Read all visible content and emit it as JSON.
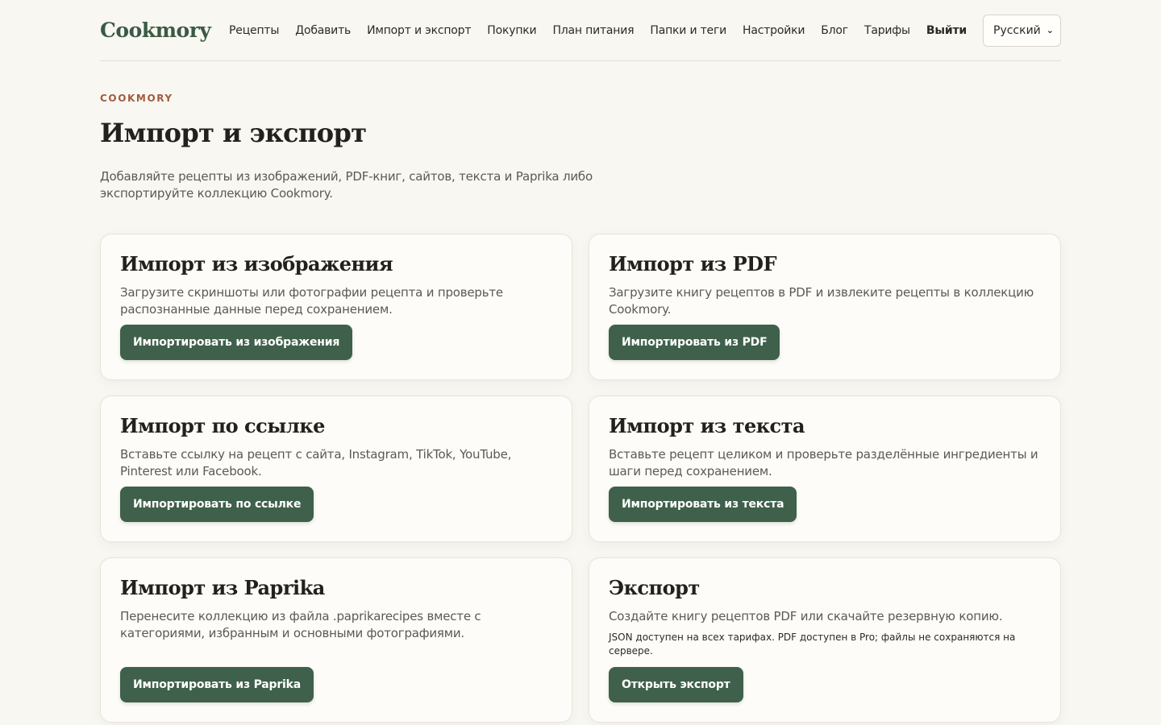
{
  "header": {
    "logo": "Cookmory",
    "nav": [
      "Рецепты",
      "Добавить",
      "Импорт и экспорт",
      "Покупки",
      "План питания",
      "Папки и теги",
      "Настройки",
      "Блог",
      "Тарифы"
    ],
    "logout": "Выйти",
    "language": "Русский"
  },
  "hero": {
    "eyebrow": "COOKMORY",
    "title": "Импорт и экспорт",
    "subtitle": "Добавляйте рецепты из изображений, PDF-книг, сайтов, текста и Paprika либо экспортируйте коллекцию Cookmory."
  },
  "cards": [
    {
      "title": "Импорт из изображения",
      "description": "Загрузите скриншоты или фотографии рецепта и проверьте распознанные данные перед сохранением.",
      "button": "Импортировать из изображения"
    },
    {
      "title": "Импорт из PDF",
      "description": "Загрузите книгу рецептов в PDF и извлеките рецепты в коллекцию Cookmory.",
      "button": "Импортировать из PDF"
    },
    {
      "title": "Импорт по ссылке",
      "description": "Вставьте ссылку на рецепт с сайта, Instagram, TikTok, YouTube, Pinterest или Facebook.",
      "button": "Импортировать по ссылке"
    },
    {
      "title": "Импорт из текста",
      "description": "Вставьте рецепт целиком и проверьте разделённые ингредиенты и шаги перед сохранением.",
      "button": "Импортировать из текста"
    },
    {
      "title": "Импорт из Paprika",
      "description": "Перенесите коллекцию из файла .paprikarecipes вместе с категориями, избранным и основными фотографиями.",
      "button": "Импортировать из Paprika"
    },
    {
      "title": "Экспорт",
      "description": "Создайте книгу рецептов PDF или скачайте резервную копию.",
      "note": "JSON доступен на всех тарифах. PDF доступен в Pro; файлы не сохраняются на сервере.",
      "button": "Открыть экспорт"
    }
  ],
  "colors": {
    "background": "#f9f7f2",
    "accent": "#3f604a",
    "eyebrow": "#a15c3e"
  }
}
